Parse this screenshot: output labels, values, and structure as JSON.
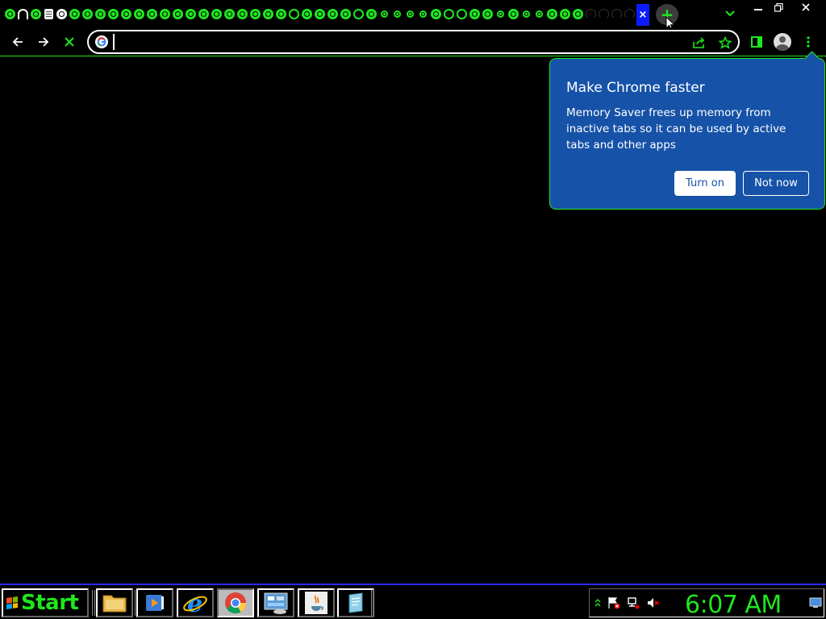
{
  "browser": {
    "tabs": [
      "chrome",
      "headset",
      "chrome",
      "doc",
      "google",
      "chrome",
      "chrome",
      "chrome",
      "chrome",
      "chrome",
      "chrome",
      "chrome",
      "chrome",
      "chrome",
      "chrome",
      "chrome",
      "chrome",
      "chrome",
      "chrome",
      "chrome",
      "chrome",
      "chrome",
      "ring",
      "chrome",
      "chrome",
      "chrome",
      "chrome",
      "ring",
      "chrome",
      "small",
      "small",
      "small",
      "small",
      "chrome",
      "ring",
      "ring",
      "chrome",
      "chrome",
      "small",
      "chrome",
      "small",
      "small",
      "chrome",
      "chrome",
      "chrome",
      "dim",
      "dim",
      "dim",
      "dim"
    ],
    "active_tab_close": "×",
    "new_tab_label": "+",
    "window_controls": {
      "minimize": "minimize-icon",
      "restore": "restore-icon",
      "close": "close-icon"
    },
    "accent": "#1ee81e"
  },
  "toolbar": {
    "omnibox_value": "",
    "omnibox_placeholder": ""
  },
  "popup": {
    "title": "Make Chrome faster",
    "body": "Memory Saver frees up memory from inactive tabs so it can be used by active tabs and other apps",
    "turn_on_label": "Turn on",
    "not_now_label": "Not now",
    "background": "#1652a8"
  },
  "taskbar": {
    "start_label": "Start",
    "apps": [
      "file-explorer",
      "media-player",
      "internet-explorer",
      "chrome",
      "control-panel",
      "java",
      "notepad"
    ],
    "clock": "6:07 AM"
  }
}
